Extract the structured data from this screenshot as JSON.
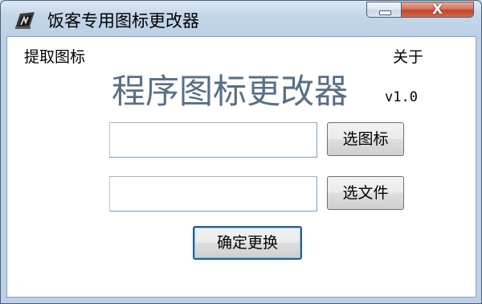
{
  "window": {
    "title": "饭客专用图标更改器",
    "minimize_label": "",
    "close_label": "X"
  },
  "menu": {
    "extract_icon": "提取图标",
    "about": "关于"
  },
  "header": {
    "app_name": "程序图标更改器",
    "version": "v1.0"
  },
  "form": {
    "icon_path": {
      "value": "",
      "button_label": "选图标"
    },
    "file_path": {
      "value": "",
      "button_label": "选文件"
    },
    "confirm_label": "确定更换"
  },
  "colors": {
    "title_color": "#596f86",
    "close_button": "#c2452a",
    "focus_border": "#3c7fb1"
  },
  "icons": {
    "app": "app-icon",
    "minimize": "minimize-icon",
    "close": "close-icon"
  }
}
